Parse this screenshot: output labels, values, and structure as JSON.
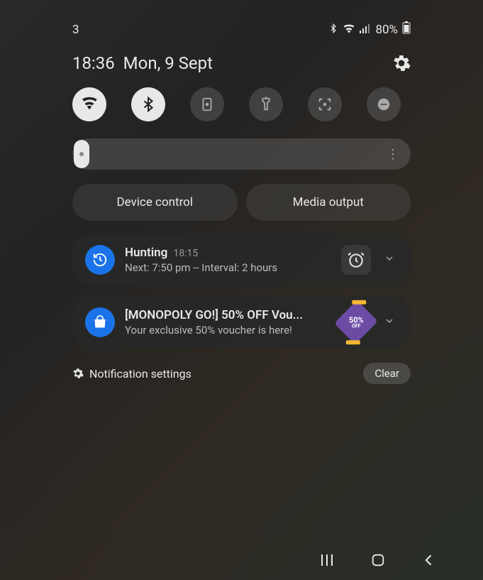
{
  "status_bar": {
    "left_indicator": "3",
    "battery_text": "80%"
  },
  "header": {
    "time": "18:36",
    "date": "Mon, 9 Sept"
  },
  "quick_toggles": {
    "wifi_active": true,
    "bluetooth_active": true,
    "rotation_active": false,
    "flashlight_active": false,
    "screencap_active": false,
    "dnd_active": false
  },
  "brightness": {
    "level": 5
  },
  "action_buttons": {
    "device_control": "Device control",
    "media_output": "Media output"
  },
  "notifications": [
    {
      "app": "Hunting",
      "time": "18:15",
      "body": "Next: 7:50 pm -- Interval: 2 hours",
      "icon_type": "clock-history",
      "thumb_type": "alarm"
    },
    {
      "app": "[MONOPOLY GO!] 50% OFF Vou...",
      "body": "Your exclusive 50% voucher is here!",
      "icon_type": "shopping-bag",
      "thumb_type": "sale",
      "sale_pct": "50%",
      "sale_sub": "OFF"
    }
  ],
  "footer": {
    "settings_label": "Notification settings",
    "clear_label": "Clear"
  }
}
